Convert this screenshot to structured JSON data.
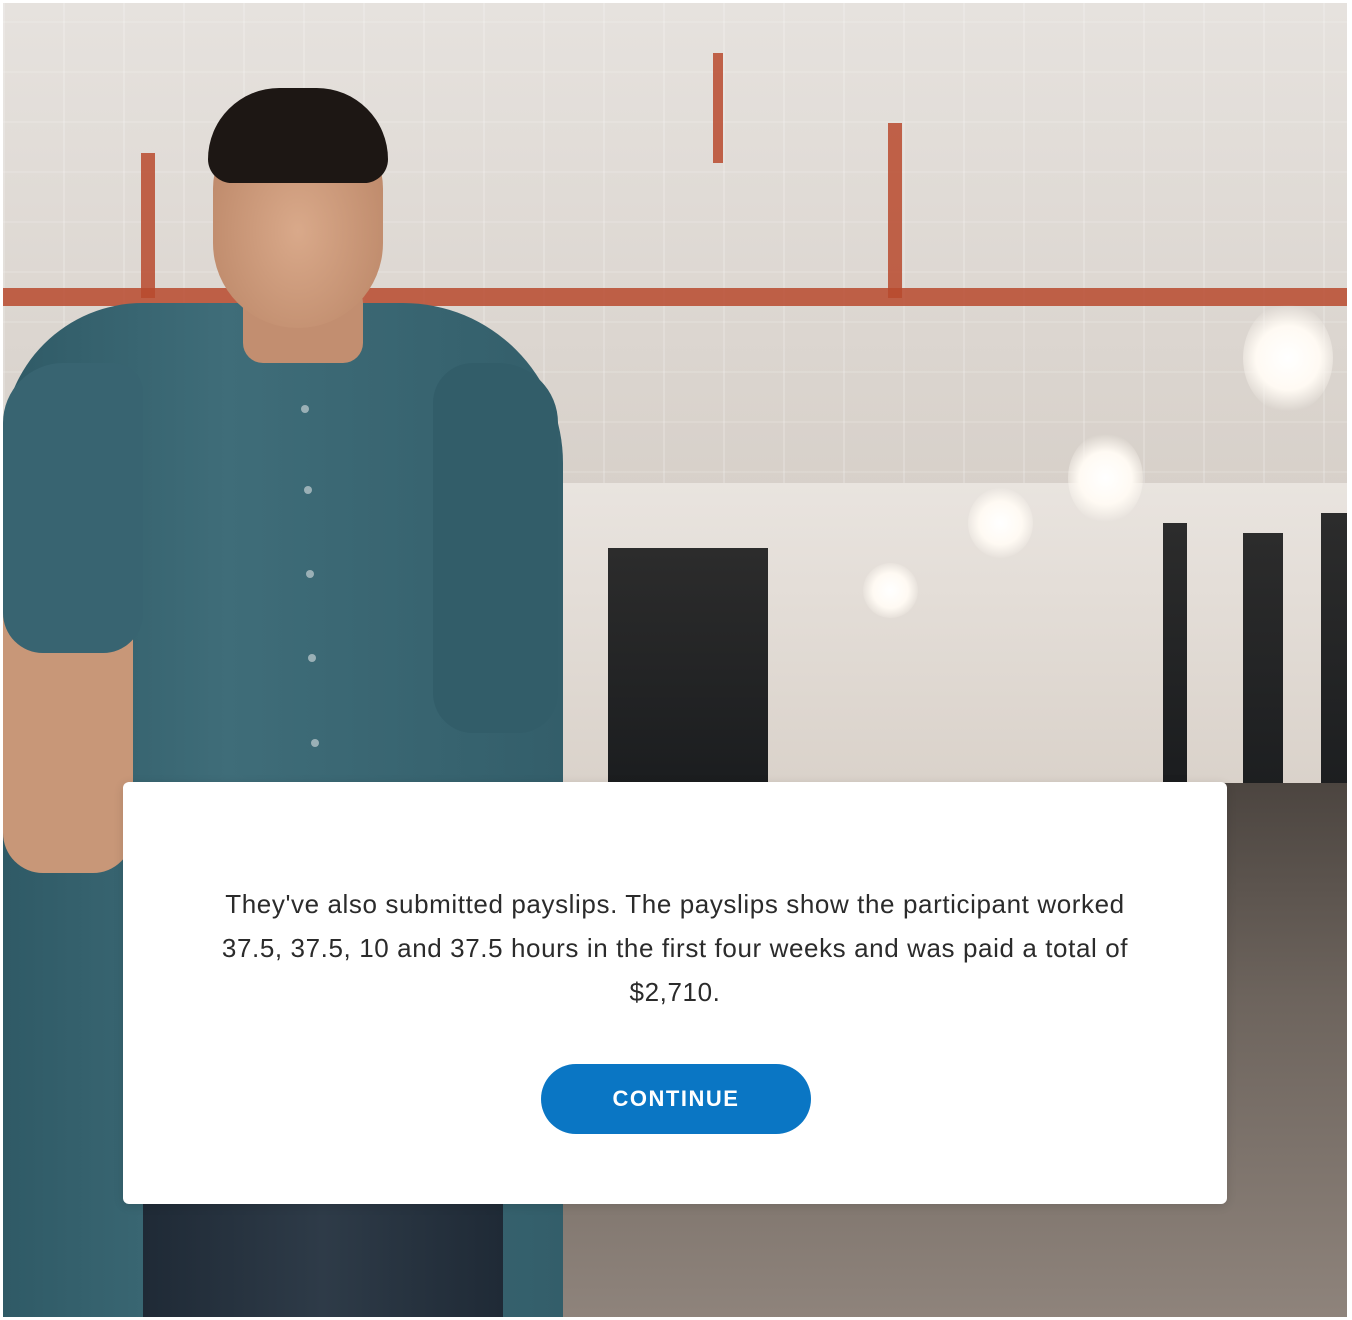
{
  "scene": {
    "background_image": "office-interior-photo",
    "character_image": "man-in-teal-shirt-photo"
  },
  "dialog": {
    "message": "They've also submitted payslips. The payslips show the participant worked 37.5, 37.5, 10 and 37.5 hours in the first four weeks and was paid a total of $2,710.",
    "continue_label": "CONTINUE"
  },
  "colors": {
    "button": "#0a76c4",
    "button_text": "#ffffff",
    "dialog_bg": "#ffffff",
    "text": "#2b2b2b"
  }
}
